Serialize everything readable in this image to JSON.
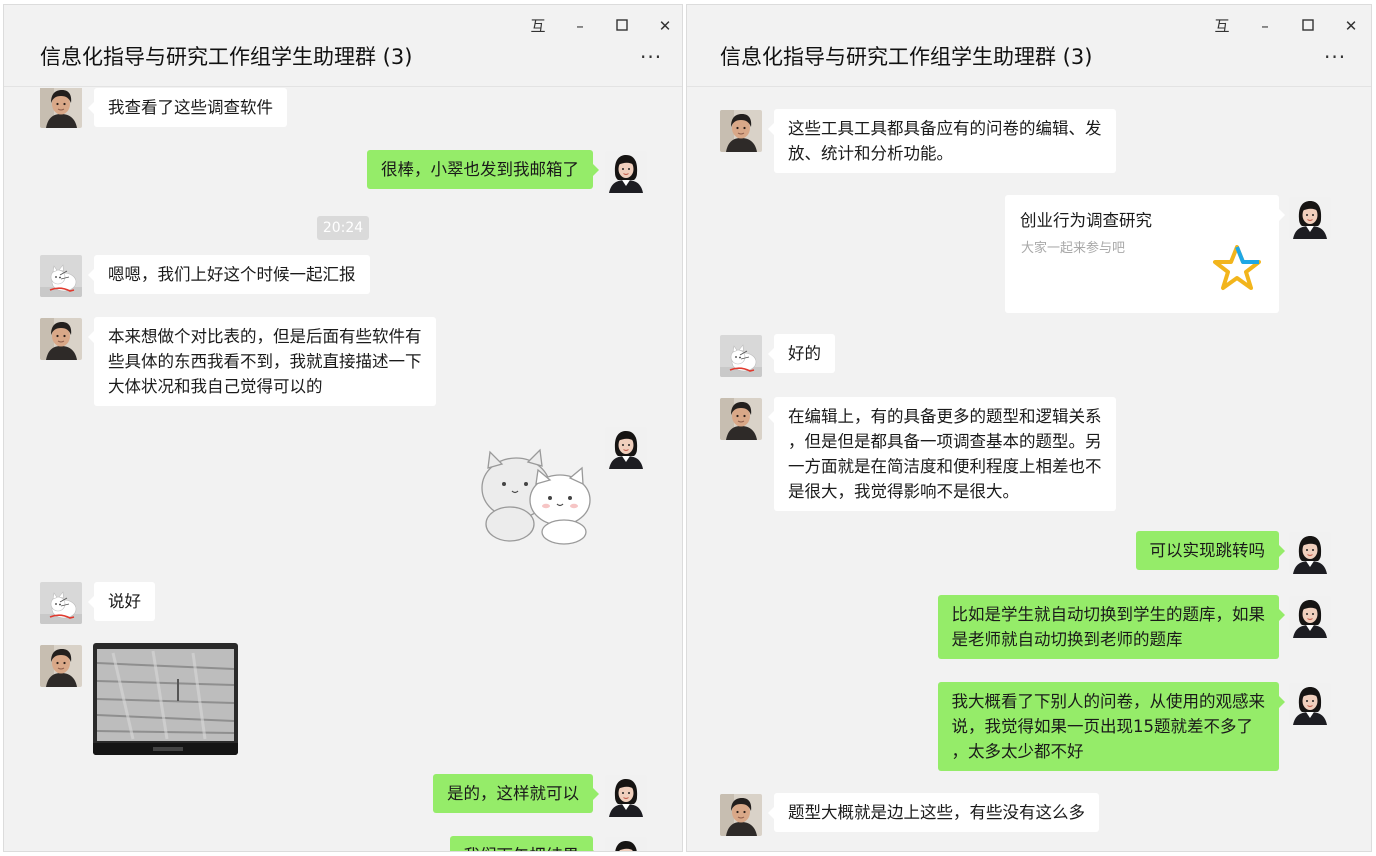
{
  "window_controls": {
    "pin": "互",
    "minimize": "–",
    "close": "✕"
  },
  "left_window": {
    "title": "信息化指导与研究工作组学生助理群 (3)",
    "more": "···",
    "timestamp": "20:24",
    "messages": [
      {
        "lines": [
          "我查看了这些调查软件"
        ]
      },
      {
        "lines": [
          "很棒，小翠也发到我邮箱了"
        ]
      },
      {
        "lines": [
          "嗯嗯，我们上好这个时候一起汇报"
        ]
      },
      {
        "lines": [
          "本来想做个对比表的，但是后面有些软件有",
          "些具体的东西我看不到，我就直接描述一下",
          "大体状况和我自己觉得可以的"
        ]
      },
      {
        "lines": [
          "说好"
        ]
      },
      {
        "lines": [
          "是的，这样就可以"
        ]
      },
      {
        "lines": [
          "我们下午把结果"
        ]
      }
    ]
  },
  "right_window": {
    "title": "信息化指导与研究工作组学生助理群 (3)",
    "more": "···",
    "card": {
      "title": "创业行为调查研究",
      "desc": "大家一起来参与吧",
      "icon": "star-icon"
    },
    "messages": [
      {
        "lines": [
          "这些工具工具都具备应有的问卷的编辑、发",
          "放、统计和分析功能。"
        ]
      },
      {
        "lines": [
          "好的"
        ]
      },
      {
        "lines": [
          "在编辑上，有的具备更多的题型和逻辑关系",
          "，但是但是都具备一项调查基本的题型。另",
          "一方面就是在简洁度和便利程度上相差也不",
          "是很大，我觉得影响不是很大。"
        ]
      },
      {
        "lines": [
          "可以实现跳转吗"
        ]
      },
      {
        "lines": [
          "比如是学生就自动切换到学生的题库，如果",
          "是老师就自动切换到老师的题库"
        ]
      },
      {
        "lines": [
          "我大概看了下别人的问卷，从使用的观感来",
          "说，我觉得如果一页出现15题就差不多了",
          "，太多太少都不好"
        ]
      },
      {
        "lines": [
          "题型大概就是边上这些，有些没有这么多"
        ]
      }
    ]
  }
}
